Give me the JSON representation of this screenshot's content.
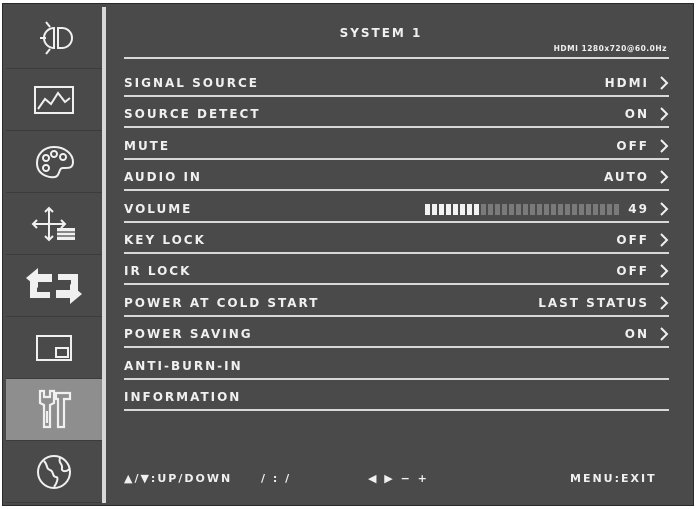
{
  "header": {
    "title": "SYSTEM 1",
    "resolution": "HDMI 1280x720@60.0Hz"
  },
  "sidebar": {
    "items": [
      {
        "icon": "brightness-icon",
        "active": false
      },
      {
        "icon": "picture-icon",
        "active": false
      },
      {
        "icon": "color-palette-icon",
        "active": false
      },
      {
        "icon": "position-icon",
        "active": false
      },
      {
        "icon": "swap-arrows-icon",
        "active": false
      },
      {
        "icon": "pip-icon",
        "active": false
      },
      {
        "icon": "tools-icon",
        "active": true
      },
      {
        "icon": "globe-icon",
        "active": false
      }
    ]
  },
  "menu": {
    "items": [
      {
        "label": "SIGNAL SOURCE",
        "value": "HDMI"
      },
      {
        "label": "SOURCE DETECT",
        "value": "ON"
      },
      {
        "label": "MUTE",
        "value": "OFF"
      },
      {
        "label": "AUDIO IN",
        "value": "AUTO"
      },
      {
        "label": "VOLUME",
        "value": "49",
        "level": 0.49
      },
      {
        "label": "KEY LOCK",
        "value": "OFF"
      },
      {
        "label": "IR LOCK",
        "value": "OFF"
      },
      {
        "label": "POWER AT COLD START",
        "value": "LAST STATUS"
      },
      {
        "label": "POWER SAVING",
        "value": "ON"
      },
      {
        "label": "ANTI-BURN-IN",
        "value": ""
      },
      {
        "label": "INFORMATION",
        "value": ""
      }
    ]
  },
  "footer": {
    "updown": "▲/▼:UP/DOWN",
    "colons": "/ : /",
    "adjust": "◀ ▶ − +",
    "exit": "MENU:EXIT"
  },
  "colors": {
    "background": "#4a4a4a",
    "active_tab": "#8e8e8e",
    "text": "#f0f0f0",
    "lines": "#d8d8d8"
  }
}
